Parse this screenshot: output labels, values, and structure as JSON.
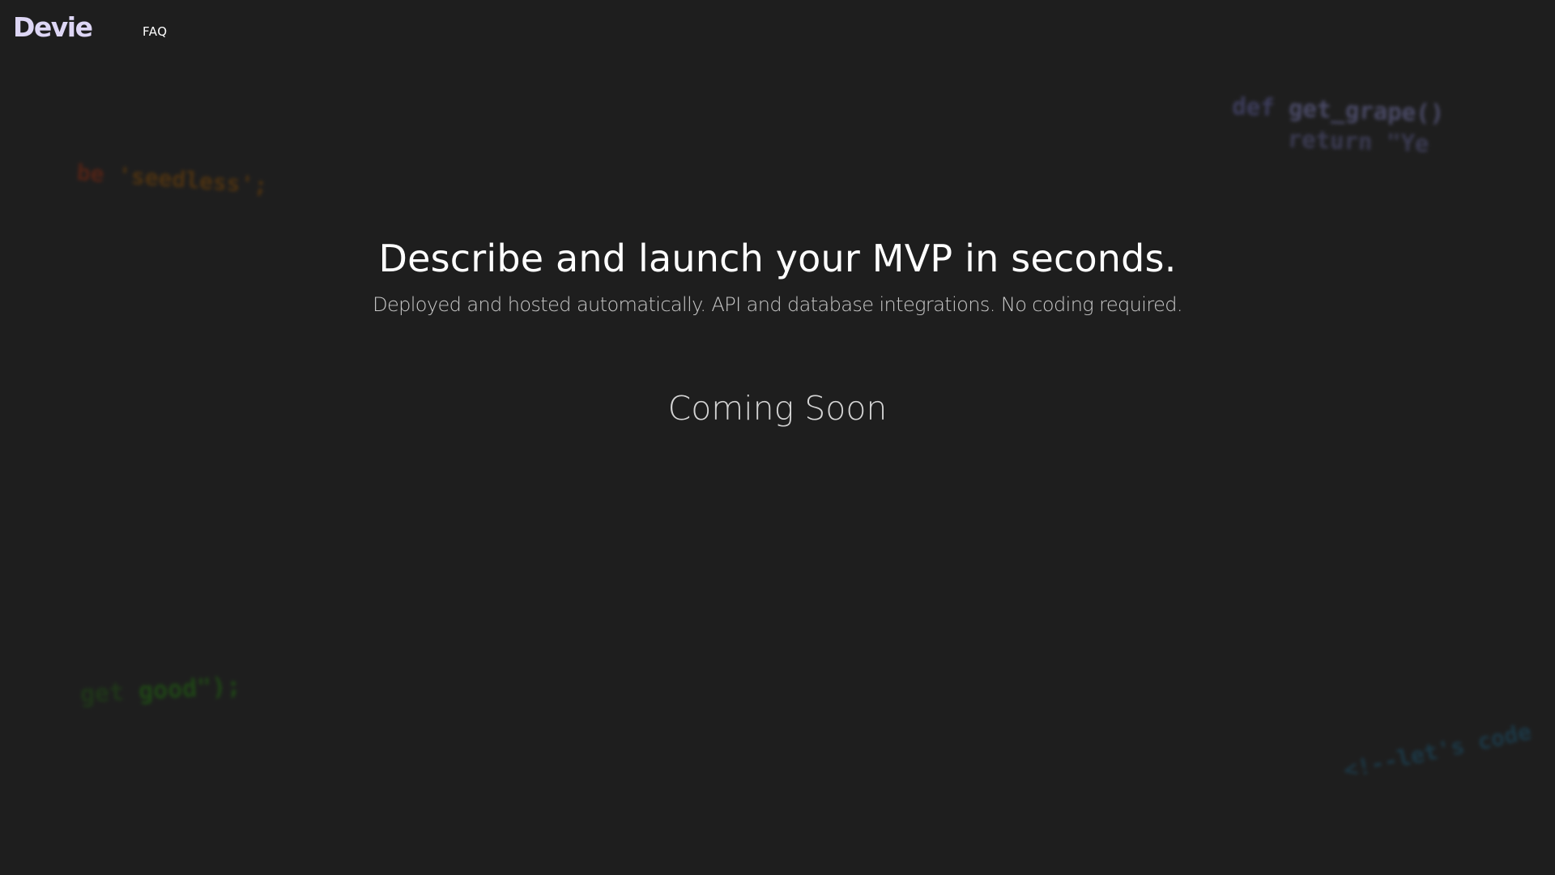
{
  "nav": {
    "logo": "Devie",
    "faq_label": "FAQ"
  },
  "hero": {
    "headline": "Describe and launch your MVP in seconds.",
    "subheadline": "Deployed and hosted automatically. API and database integrations. No coding required.",
    "status": "Coming Soon"
  },
  "background_code": {
    "grape_line1_keyword": "def",
    "grape_line1_rest": " get_grape()",
    "grape_line2": "    return \"Ye",
    "seedless_prefix": "be",
    "seedless_rest": " 'seedless';",
    "good_prefix": "get",
    "good_rest": " good\");",
    "lets_code": "<!--let's code"
  },
  "colors": {
    "background": "#1e1e1e",
    "logo": "#ddd6f5",
    "headline": "#ffffff",
    "subheadline": "#c9c9c9",
    "status": "#d4d4d4"
  }
}
